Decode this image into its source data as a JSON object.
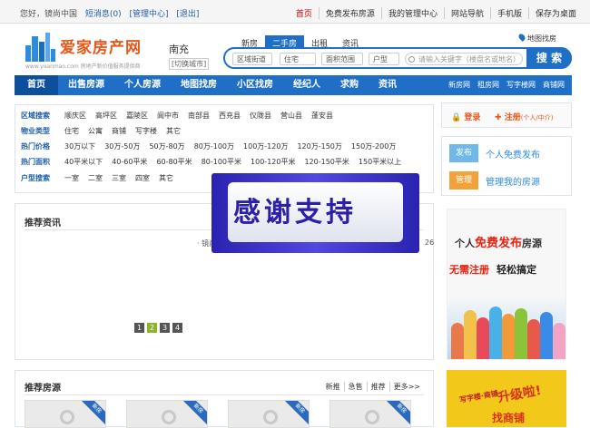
{
  "topbar": {
    "greeting": "您好，镜尚中国",
    "messages": "短消息(0)",
    "manage": "[管理中心]",
    "logout": "[退出]",
    "links": [
      "首页",
      "免费发布房源",
      "我的管理中心",
      "网站导航",
      "手机版",
      "保存为桌面"
    ]
  },
  "logo": {
    "name": "爱家房产网",
    "tagline": "www.yuanmao.com 房地产新价值服务提供商"
  },
  "city": {
    "name": "南充",
    "switch": "[切换城市]"
  },
  "search": {
    "tabs": [
      "新房",
      "二手房",
      "出租",
      "资讯"
    ],
    "active_tab": "二手房",
    "selects": [
      "区域街道",
      "住宅",
      "面积范围",
      "户型"
    ],
    "placeholder": "请输入关键字（楼盘名或地名）",
    "button": "搜 索",
    "map_link": "地图找房"
  },
  "nav": {
    "main": [
      "首页",
      "出售房源",
      "个人房源",
      "地图找房",
      "小区找房",
      "经纪人",
      "求购",
      "资讯"
    ],
    "side": [
      "新房网",
      "租房网",
      "写字楼网",
      "商铺网"
    ]
  },
  "filters": [
    {
      "label": "区域搜索",
      "options": [
        "顺庆区",
        "高坪区",
        "嘉陵区",
        "阆中市",
        "南部县",
        "西充县",
        "仪陇县",
        "营山县",
        "蓬安县"
      ]
    },
    {
      "label": "物业类型",
      "options": [
        "住宅",
        "公寓",
        "商铺",
        "写字楼",
        "其它"
      ]
    },
    {
      "label": "热门价格",
      "options": [
        "30万以下",
        "30万-50万",
        "50万-80万",
        "80万-100万",
        "100万-120万",
        "120万-150万",
        "150万-200万"
      ]
    },
    {
      "label": "热门面积",
      "options": [
        "40平米以下",
        "40-60平米",
        "60-80平米",
        "80-100平米",
        "100-120平米",
        "120-150平米",
        "150平米以上"
      ]
    },
    {
      "label": "户型搜索",
      "options": [
        "一室",
        "二室",
        "三室",
        "四室",
        "其它"
      ]
    }
  ],
  "news": {
    "title": "推荐资讯",
    "ticker": "· 镜尚",
    "date": "26",
    "pages": [
      "1",
      "2",
      "3",
      "4"
    ],
    "active_page": "2"
  },
  "recommend": {
    "title": "推荐房源",
    "tabs": [
      "新推",
      "急售",
      "推荐",
      "更多>>"
    ],
    "ribbon": "新房"
  },
  "sidebar": {
    "login": "登录",
    "register": "注册",
    "register_note": "(个人/中介)",
    "publish_tag": "发布",
    "publish_text": "个人免费发布",
    "manage_tag": "管理",
    "manage_text": "管理我的房源"
  },
  "ads": {
    "ad1_line1_a": "个人",
    "ad1_line1_b": "免费发布",
    "ad1_line1_c": "房源",
    "ad1_line2_a": "无需注册",
    "ad1_line2_b": "轻松搞定",
    "ad2_a": "写字楼·商铺",
    "ad2_b": "升级啦!",
    "ad2_c": "找商铺"
  },
  "overlay": {
    "text": "感谢支持"
  },
  "colors": {
    "primary": "#1f6fc6",
    "accent": "#e8561b",
    "overlay": "#3a32c8"
  }
}
